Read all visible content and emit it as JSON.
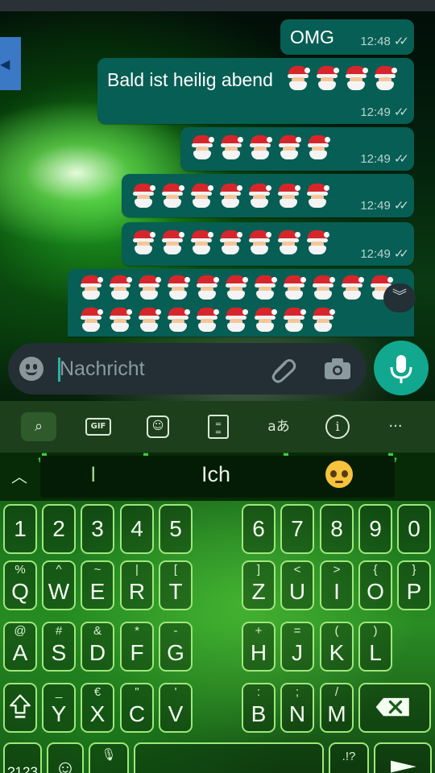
{
  "colors": {
    "bubble": "#075e54",
    "accent": "#11a88f",
    "keyboard_key_border": "#9ee87a"
  },
  "chat": {
    "messages": [
      {
        "text": "OMG",
        "time": "12:48",
        "ticks": "✓✓"
      },
      {
        "text": "Bald ist heilig abend",
        "emoji_count": 4,
        "time": "12:49",
        "ticks": "✓✓"
      },
      {
        "emoji_count": 5,
        "time": "12:49",
        "ticks": "✓✓"
      },
      {
        "emoji_count": 7,
        "time": "12:49",
        "ticks": "✓✓"
      },
      {
        "emoji_count": 7,
        "time": "12:49",
        "ticks": "✓✓"
      },
      {
        "emoji_rows": [
          11,
          9
        ]
      }
    ],
    "emoji_name": "santa-claus-emoji",
    "scroll_down_icon": "double-chevron-down-icon"
  },
  "input": {
    "placeholder": "Nachricht",
    "emoji_icon": "smiley-icon",
    "attach_icon": "paperclip-icon",
    "camera_icon": "camera-icon",
    "mic_icon": "microphone-icon"
  },
  "keyboard": {
    "toolbar": {
      "gif": "GIF",
      "more": "···",
      "translate": "aあ"
    },
    "suggestions": [
      "I",
      "Ich",
      "pleading-face-emoji"
    ],
    "number_row": [
      "1",
      "2",
      "3",
      "4",
      "5",
      "6",
      "7",
      "8",
      "9",
      "0"
    ],
    "row1": [
      {
        "main": "Q",
        "sub": "%"
      },
      {
        "main": "W",
        "sub": "^"
      },
      {
        "main": "E",
        "sub": "~"
      },
      {
        "main": "R",
        "sub": "|"
      },
      {
        "main": "T",
        "sub": "["
      },
      {
        "main": "Z",
        "sub": "]"
      },
      {
        "main": "U",
        "sub": "<"
      },
      {
        "main": "I",
        "sub": ">"
      },
      {
        "main": "O",
        "sub": "{"
      },
      {
        "main": "P",
        "sub": "}"
      }
    ],
    "row2": [
      {
        "main": "A",
        "sub": "@"
      },
      {
        "main": "S",
        "sub": "#"
      },
      {
        "main": "D",
        "sub": "&"
      },
      {
        "main": "F",
        "sub": "*"
      },
      {
        "main": "G",
        "sub": "-"
      },
      {
        "main": "H",
        "sub": "+"
      },
      {
        "main": "J",
        "sub": "="
      },
      {
        "main": "K",
        "sub": "("
      },
      {
        "main": "L",
        "sub": ")"
      }
    ],
    "row3": [
      {
        "main": "Y",
        "sub": "_"
      },
      {
        "main": "X",
        "sub": "€"
      },
      {
        "main": "C",
        "sub": "\""
      },
      {
        "main": "V",
        "sub": "'"
      },
      {
        "main": "B",
        "sub": ":"
      },
      {
        "main": "N",
        "sub": ";"
      },
      {
        "main": "M",
        "sub": "/"
      }
    ],
    "bottom_row": {
      "numbers": "?123",
      "punct": ".!?",
      "comma": ","
    }
  }
}
